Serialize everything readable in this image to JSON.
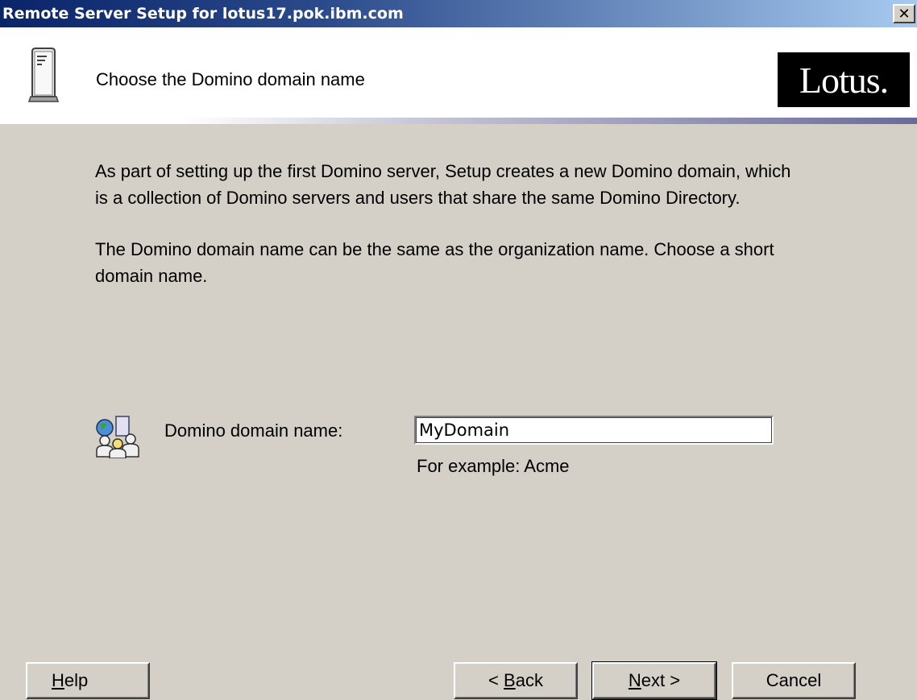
{
  "window": {
    "title": "Remote Server Setup for lotus17.pok.ibm.com",
    "close_glyph": "✕"
  },
  "header": {
    "title": "Choose the Domino domain name",
    "logo_text": "Lotus.",
    "icon": "server-tower-icon"
  },
  "body": {
    "paragraph1_line1": "As part of setting up the first Domino server, Setup creates a new Domino domain, which",
    "paragraph1_line2": "is a collection of Domino servers and users that share the same Domino Directory.",
    "paragraph2_line1": "The Domino domain name can be the same as the organization name. Choose a short",
    "paragraph2_line2": "domain name."
  },
  "form": {
    "label": "Domino domain name:",
    "value": "MyDomain",
    "example": "For example: Acme",
    "icon": "domain-users-icon"
  },
  "buttons": {
    "help_mnemonic": "H",
    "help_rest": "elp",
    "back_prefix": "< ",
    "back_mnemonic": "B",
    "back_rest": "ack",
    "next_mnemonic": "N",
    "next_rest": "ext >",
    "cancel": "Cancel"
  }
}
